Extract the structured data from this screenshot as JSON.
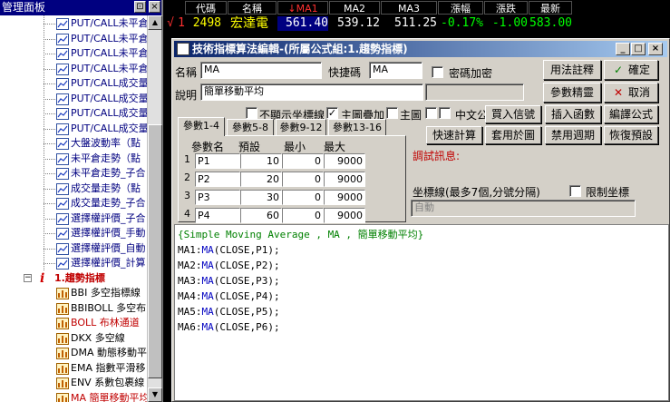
{
  "left_panel": {
    "title": "管理面板",
    "pin_icon": "pin-icon",
    "close_icon": "close-icon",
    "items_top": [
      "PUT/CALL未平倉",
      "PUT/CALL未平倉",
      "PUT/CALL未平倉",
      "PUT/CALL未平倉",
      "PUT/CALL成交量",
      "PUT/CALL成交量",
      "PUT/CALL成交量",
      "PUT/CALL成交量",
      "大盤波動率（點",
      "未平倉走勢（點",
      "未平倉走勢_子合",
      "成交量走勢（點",
      "成交量走勢_子合",
      "選擇權評價_子合",
      "選擇權評價_手動",
      "選擇權評價_自動",
      "選擇權評價_計算"
    ],
    "folder": {
      "icon_text": "i",
      "label": "1.趨勢指標"
    },
    "items_bottom": [
      {
        "text": "BBI 多空指標線",
        "color": "black"
      },
      {
        "text": "BBIBOLL 多空布",
        "color": "black"
      },
      {
        "text": "BOLL 布林通道",
        "color": "red"
      },
      {
        "text": "DKX 多空線",
        "color": "black"
      },
      {
        "text": "DMA 動態移動平",
        "color": "black"
      },
      {
        "text": "EMA 指數平滑移",
        "color": "black"
      },
      {
        "text": "ENV 系數包裹線",
        "color": "black"
      },
      {
        "text": "MA 簡單移動平均",
        "color": "red"
      }
    ]
  },
  "quote": {
    "headers": [
      "代碼",
      "名稱",
      "↓MA1",
      "MA2",
      "MA3",
      "漲幅",
      "漲跌",
      "最新"
    ],
    "row": {
      "marker": "√",
      "index": "1",
      "code": "2498",
      "name": "宏達電",
      "ma1": "561.40",
      "ma2": "539.12",
      "ma3": "511.25",
      "change_pct": "-0.17%",
      "change": "-1.00",
      "last": "583.00"
    },
    "colors": {
      "up": "#ff3030",
      "down": "#00ff00",
      "name": "#ffff00",
      "value": "#ffffff"
    }
  },
  "dialog": {
    "title": "技術指標算法編輯-(所屬公式組:1.趨勢指標)",
    "window_buttons": [
      "_",
      "□",
      "×"
    ],
    "name_label": "名稱",
    "name_value": "MA",
    "shortcut_label": "快捷碼",
    "shortcut_value": "MA",
    "password_label": "密碼加密",
    "desc_label": "說明",
    "desc_value": "簡單移動平均",
    "desc_extra_value": "",
    "checkboxes": {
      "hide_axis": {
        "label": "不顯示坐標線",
        "checked": true
      },
      "main_overlay": {
        "label": "主圖疊加",
        "checked": false
      },
      "main_chart": {
        "label": "主圖",
        "checked": false
      },
      "chinese_formula": {
        "label": "中文公式",
        "checked": false
      }
    },
    "buttons": {
      "usage": "用法註釋",
      "ok": "確定",
      "param_tune": "參數精靈",
      "cancel": "取消",
      "buy_sell": "買入信號",
      "insert_func": "插入函數",
      "compile": "編譯公式",
      "quick_calc": "快速計算",
      "apply_chart": "套用於圖",
      "disable_period": "禁用週期",
      "restore_default": "恢復預設"
    },
    "tabs": [
      "參數1-4",
      "參數5-8",
      "參數9-12",
      "參數13-16"
    ],
    "param_headers": [
      "參數名",
      "預設",
      "最小",
      "最大"
    ],
    "params": [
      {
        "row": "1",
        "name": "P1",
        "default": "10",
        "min": "0",
        "max": "9000"
      },
      {
        "row": "2",
        "name": "P2",
        "default": "20",
        "min": "0",
        "max": "9000"
      },
      {
        "row": "3",
        "name": "P3",
        "default": "30",
        "min": "0",
        "max": "9000"
      },
      {
        "row": "4",
        "name": "P4",
        "default": "60",
        "min": "0",
        "max": "9000"
      }
    ],
    "debug_label": "調試訊息:",
    "axis_label": "坐標線(最多7個,分號分隔)",
    "limit_axis_label": "限制坐標",
    "axis_value": "自動",
    "code": {
      "comment": "{Simple Moving Average , MA , 簡單移動平均}",
      "lines": [
        {
          "var": "MA1:",
          "fn": "MA",
          "args": "(CLOSE,P1);"
        },
        {
          "var": "MA2:",
          "fn": "MA",
          "args": "(CLOSE,P2);"
        },
        {
          "var": "MA3:",
          "fn": "MA",
          "args": "(CLOSE,P3);"
        },
        {
          "var": "MA4:",
          "fn": "MA",
          "args": "(CLOSE,P4);"
        },
        {
          "var": "MA5:",
          "fn": "MA",
          "args": "(CLOSE,P5);"
        },
        {
          "var": "MA6:",
          "fn": "MA",
          "args": "(CLOSE,P6);"
        }
      ]
    }
  }
}
